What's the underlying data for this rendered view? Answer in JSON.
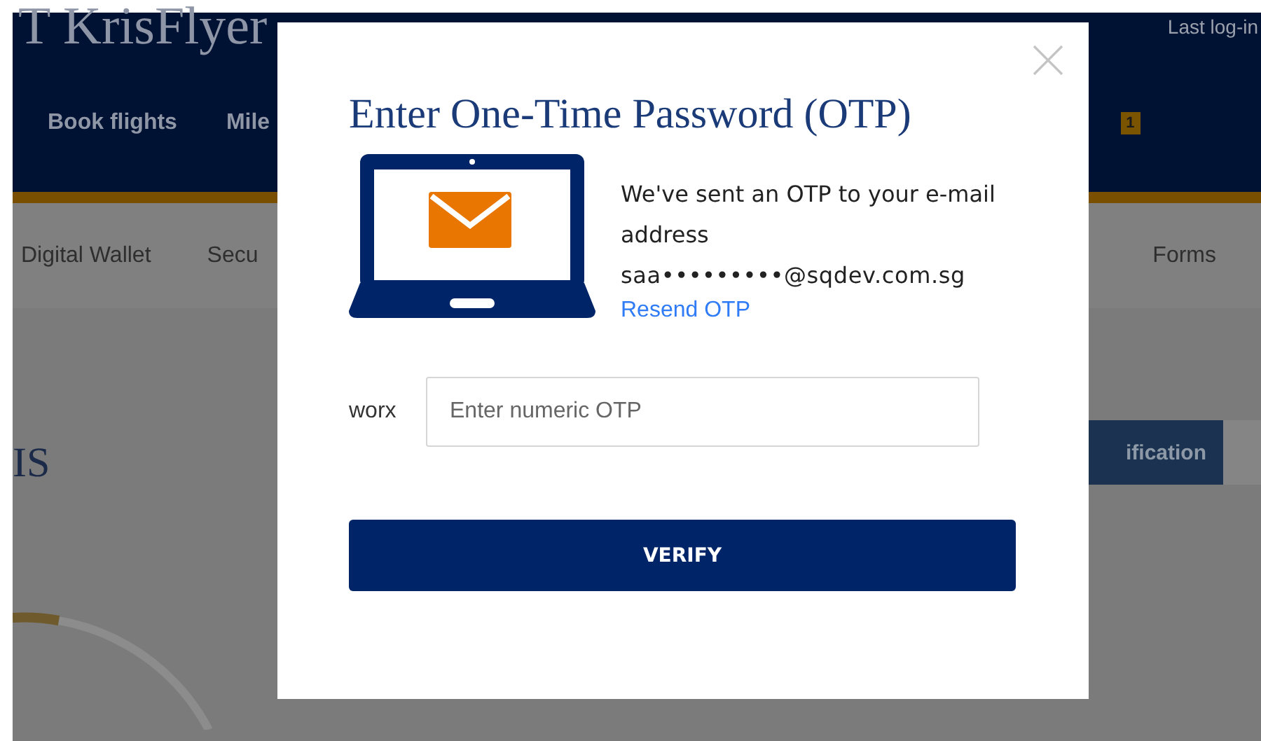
{
  "header": {
    "title": "T KrisFlyer",
    "last_login": "Last log-in",
    "nav": [
      "Book flights",
      "Mile"
    ],
    "badge": "1"
  },
  "subnav": [
    "Digital Wallet",
    "Secu",
    "Forms"
  ],
  "content": {
    "heading": "IS",
    "tab": "ification"
  },
  "dialog": {
    "title": "Enter One-Time Password (OTP)",
    "message": "We've sent an OTP to your e-mail address",
    "email": "saa•••••••••@sqdev.com.sg",
    "resend_link": "Resend OTP",
    "field_label": "worx",
    "otp_field": {
      "placeholder": "Enter numeric OTP"
    },
    "verify_button": "VERIFY"
  }
}
